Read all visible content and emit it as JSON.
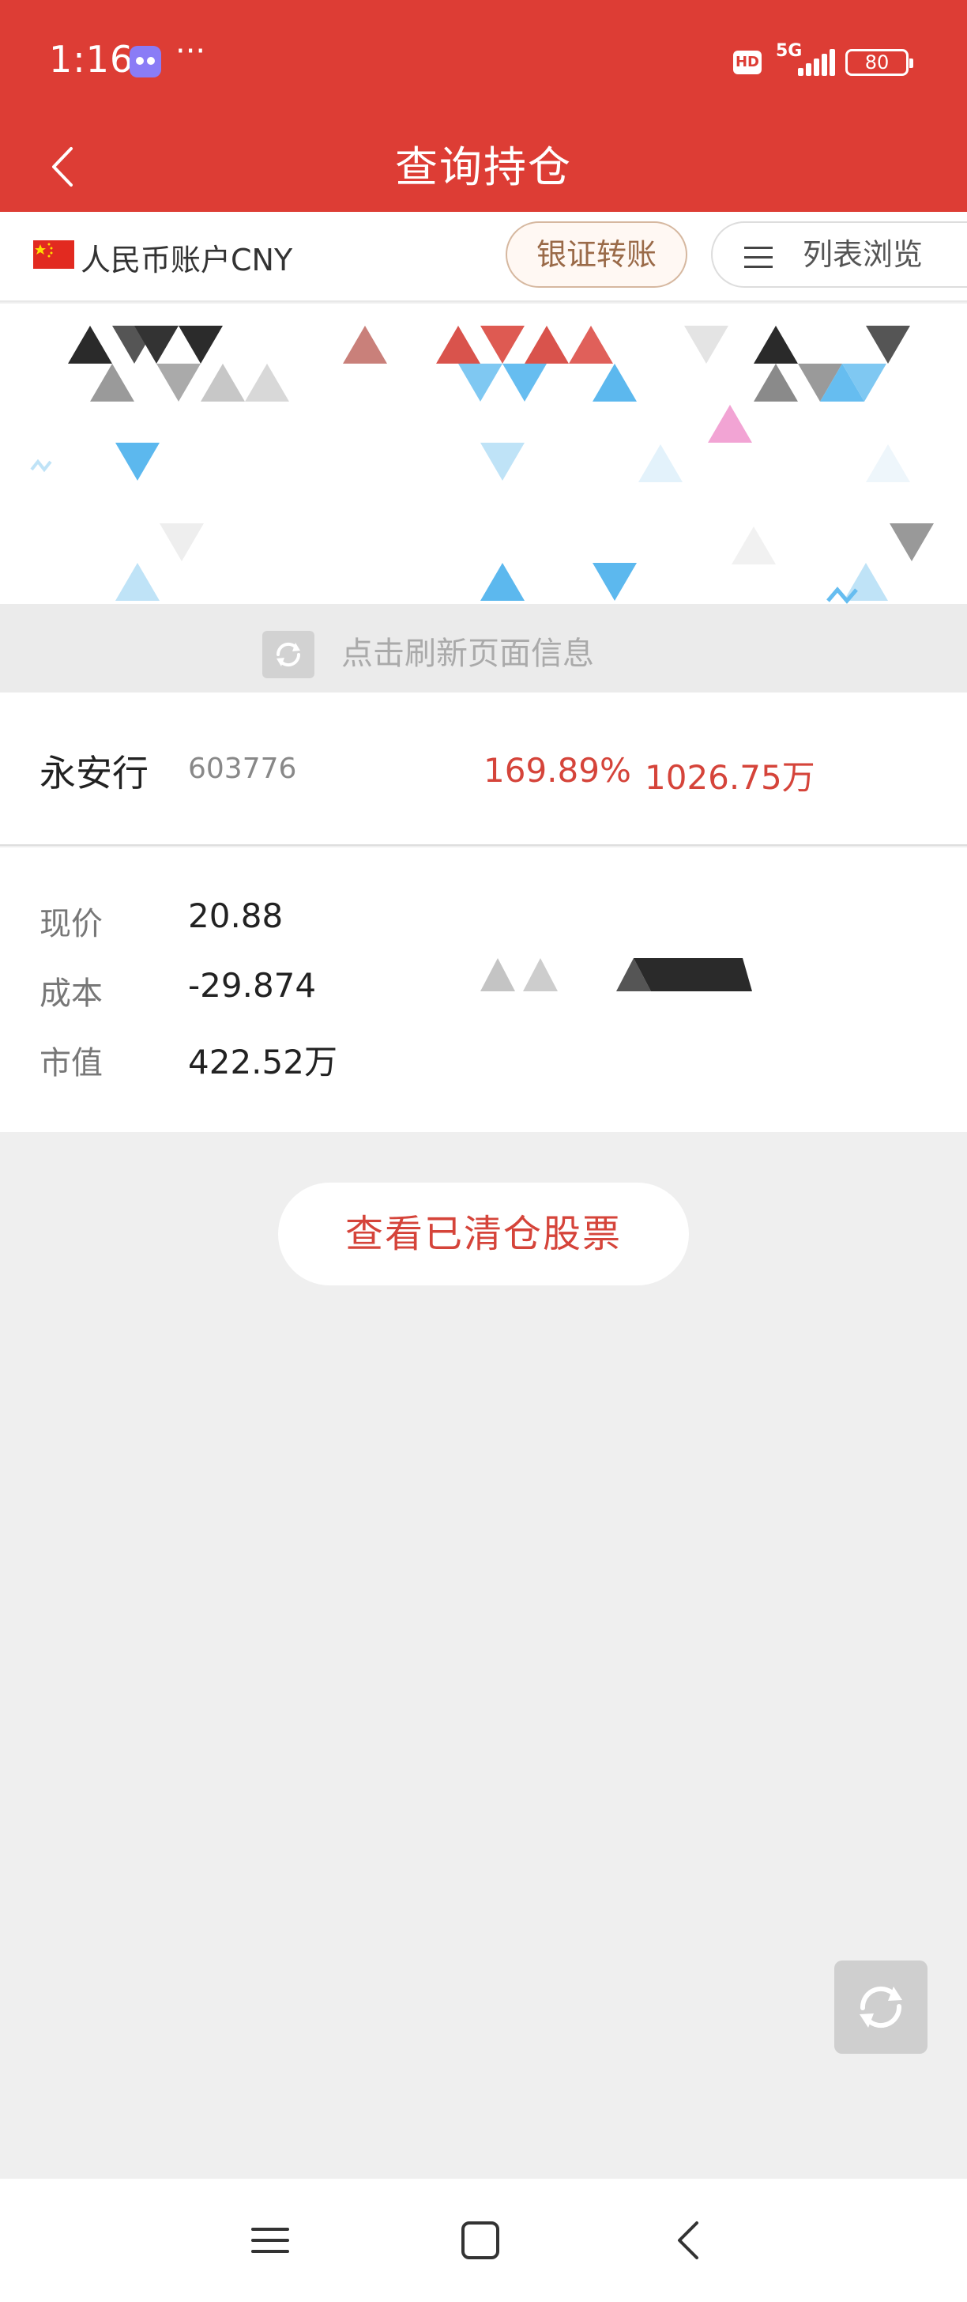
{
  "status_bar": {
    "time": "1:16",
    "more": "···",
    "hd": "HD",
    "network": "5G",
    "battery": "80",
    "app_icon": "purple-app-icon"
  },
  "header": {
    "title": "查询持仓",
    "back_icon": "back-chevron-icon",
    "background": "#dd3d35"
  },
  "account_bar": {
    "account_label": "人民币账户CNY",
    "flag_icon": "china-flag-icon",
    "transfer_button": "银证转账",
    "list_view_button": "列表浏览",
    "list_icon": "list-icon"
  },
  "refresh_strip": {
    "text": "点击刷新页面信息",
    "icon": "refresh-icon"
  },
  "position": {
    "name": "永安行",
    "code": "603776",
    "profit_pct": "169.89%",
    "profit_amount": "1026.75万",
    "details": [
      {
        "label": "现价",
        "value": "20.88"
      },
      {
        "label": "成本",
        "value": "-29.874"
      },
      {
        "label": "市值",
        "value": "422.52万"
      }
    ]
  },
  "cleared_button": "查看已清仓股票",
  "floating_refresh_icon": "refresh-icon",
  "nav_bar": {
    "menu_icon": "menu-icon",
    "home_icon": "home-square-icon",
    "back_icon": "back-icon"
  },
  "colors": {
    "accent": "#dd3d35",
    "profit_red": "#d5443a",
    "background": "#efefef"
  }
}
